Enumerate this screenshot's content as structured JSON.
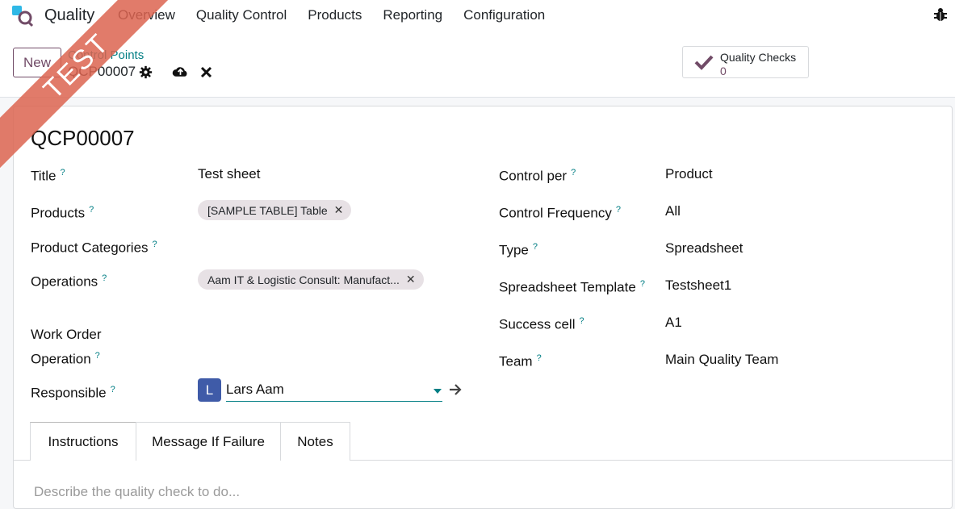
{
  "app": {
    "name": "Quality",
    "ribbon": "TEST"
  },
  "menu": [
    "Overview",
    "Quality Control",
    "Products",
    "Reporting",
    "Configuration"
  ],
  "control_panel": {
    "new_label": "New",
    "breadcrumb_parent": "Control Points",
    "breadcrumb_current": "QCP00007",
    "smart_button": {
      "label": "Quality Checks",
      "value": "0"
    }
  },
  "record": {
    "name": "QCP00007",
    "left_fields": {
      "title": {
        "label": "Title",
        "value": "Test sheet"
      },
      "products": {
        "label": "Products",
        "tags": [
          "[SAMPLE TABLE] Table"
        ]
      },
      "product_categories": {
        "label": "Product Categories"
      },
      "operations": {
        "label": "Operations",
        "tags": [
          "Aam IT & Logistic Consult: Manufact..."
        ]
      },
      "work_order_operation": {
        "label_line1": "Work Order",
        "label_line2": "Operation"
      },
      "responsible": {
        "label": "Responsible",
        "avatar": "L",
        "value": "Lars Aam"
      }
    },
    "right_fields": {
      "control_per": {
        "label": "Control per",
        "value": "Product"
      },
      "control_frequency": {
        "label": "Control Frequency",
        "value": "All"
      },
      "type": {
        "label": "Type",
        "value": "Spreadsheet"
      },
      "spreadsheet_template": {
        "label": "Spreadsheet Template",
        "value": "Testsheet1"
      },
      "success_cell": {
        "label": "Success cell",
        "value": "A1"
      },
      "team": {
        "label": "Team",
        "value": "Main Quality Team"
      }
    },
    "help_marker": "?"
  },
  "tabs": [
    {
      "label": "Instructions",
      "active": true
    },
    {
      "label": "Message If Failure",
      "active": false
    },
    {
      "label": "Notes",
      "active": false
    }
  ],
  "instructions_placeholder": "Describe the quality check to do...",
  "colors": {
    "brand": "#714b67",
    "link": "#017e84",
    "avatar": "#3f5ba8",
    "ribbon": "#dc6450"
  },
  "icons": [
    "app-logo-icon",
    "bug-icon",
    "gear-icon",
    "cloud-save-icon",
    "discard-icon",
    "check-icon",
    "caret-down-icon",
    "arrow-right-icon",
    "remove-tag-icon"
  ]
}
